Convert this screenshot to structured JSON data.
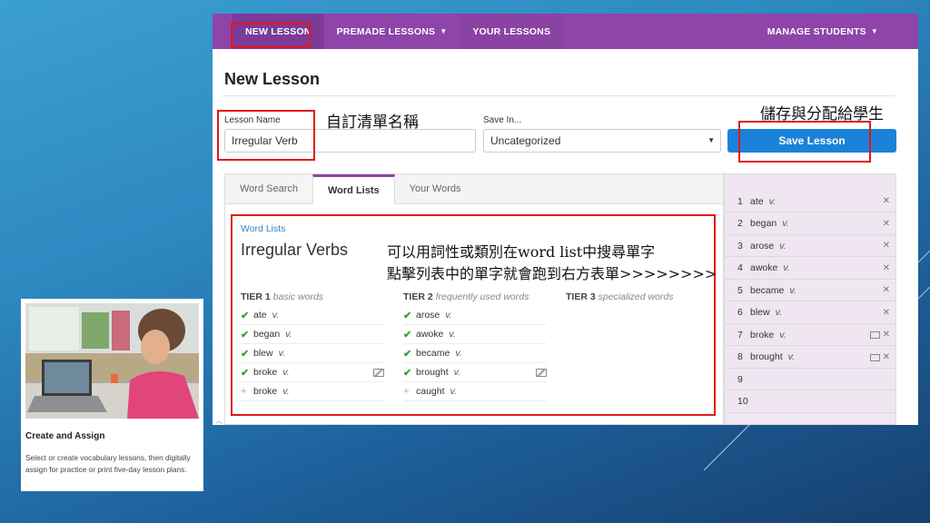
{
  "nav": {
    "new_lesson": "NEW LESSON",
    "premade": "PREMADE LESSONS",
    "your_lessons": "YOUR LESSONS",
    "manage": "MANAGE STUDENTS",
    "accent_color": "#8e44a8"
  },
  "page_title": "New Lesson",
  "form": {
    "name_label": "Lesson Name",
    "name_value": "Irregular Verb",
    "save_in_label": "Save In...",
    "save_in_value": "Uncategorized",
    "save_button": "Save Lesson"
  },
  "tabs": [
    "Word Search",
    "Word Lists",
    "Your Words"
  ],
  "list": {
    "breadcrumb": "Word Lists",
    "title": "Irregular Verbs",
    "tiers": [
      {
        "name": "TIER 1",
        "desc": "basic words"
      },
      {
        "name": "TIER 2",
        "desc": "frequently used words"
      },
      {
        "name": "TIER 3",
        "desc": "specialized words"
      }
    ],
    "tier1_words": [
      {
        "word": "ate",
        "pos": "v.",
        "checked": true,
        "image": false
      },
      {
        "word": "began",
        "pos": "v.",
        "checked": true,
        "image": false
      },
      {
        "word": "blew",
        "pos": "v.",
        "checked": true,
        "image": false
      },
      {
        "word": "broke",
        "pos": "v.",
        "checked": true,
        "image": true
      },
      {
        "word": "broke",
        "pos": "v.",
        "checked": false,
        "image": false
      }
    ],
    "tier2_words": [
      {
        "word": "arose",
        "pos": "v.",
        "checked": true,
        "image": false
      },
      {
        "word": "awoke",
        "pos": "v.",
        "checked": true,
        "image": false
      },
      {
        "word": "became",
        "pos": "v.",
        "checked": true,
        "image": false
      },
      {
        "word": "brought",
        "pos": "v.",
        "checked": true,
        "image": true
      },
      {
        "word": "caught",
        "pos": "v.",
        "checked": false,
        "image": false
      }
    ]
  },
  "selected_words": [
    {
      "num": "1",
      "word": "ate",
      "pos": "v.",
      "image": false,
      "removable": true
    },
    {
      "num": "2",
      "word": "began",
      "pos": "v.",
      "image": false,
      "removable": true
    },
    {
      "num": "3",
      "word": "arose",
      "pos": "v.",
      "image": false,
      "removable": true
    },
    {
      "num": "4",
      "word": "awoke",
      "pos": "v.",
      "image": false,
      "removable": true
    },
    {
      "num": "5",
      "word": "became",
      "pos": "v.",
      "image": false,
      "removable": true
    },
    {
      "num": "6",
      "word": "blew",
      "pos": "v.",
      "image": false,
      "removable": true
    },
    {
      "num": "7",
      "word": "broke",
      "pos": "v.",
      "image": true,
      "removable": true
    },
    {
      "num": "8",
      "word": "brought",
      "pos": "v.",
      "image": true,
      "removable": true
    },
    {
      "num": "9",
      "word": "",
      "pos": "",
      "image": false,
      "removable": false
    },
    {
      "num": "10",
      "word": "",
      "pos": "",
      "image": false,
      "removable": false
    }
  ],
  "annotations": {
    "name_note": "自訂清單名稱",
    "save_note": "儲存與分配給學生",
    "list_note_1": "可以用詞性或類別在word list中搜尋單字",
    "list_note_2": "點擊列表中的單字就會跑到右方表單>>>>>>>>"
  },
  "card": {
    "title": "Create and Assign",
    "desc": "Select or create vocabulary lessons, then digitally assign for practice or print five-day lesson plans."
  }
}
